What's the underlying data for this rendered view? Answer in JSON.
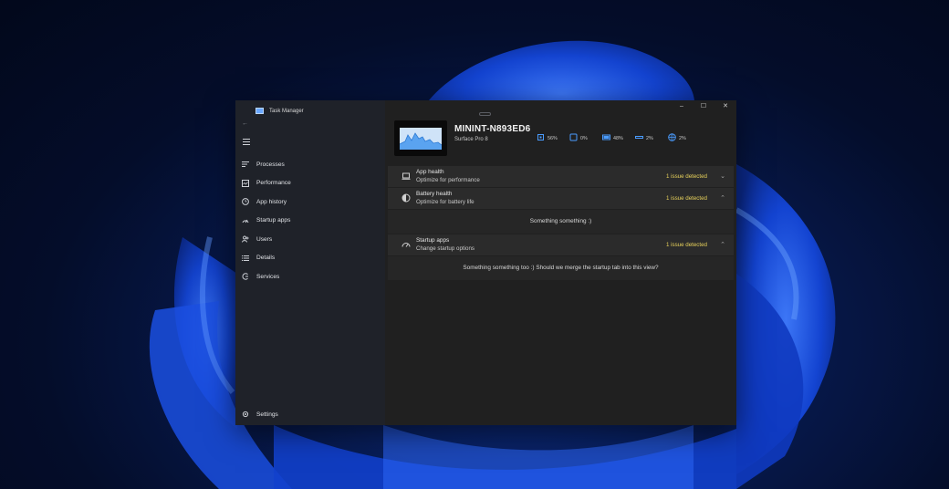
{
  "window": {
    "title": "Task Manager",
    "controls": {
      "minimize": "–",
      "maximize": "☐",
      "close": "✕"
    }
  },
  "sidebar": {
    "back": "←",
    "items": [
      {
        "label": "Processes",
        "icon": "list-icon"
      },
      {
        "label": "Performance",
        "icon": "performance-icon"
      },
      {
        "label": "App history",
        "icon": "history-icon"
      },
      {
        "label": "Startup apps",
        "icon": "startup-icon"
      },
      {
        "label": "Users",
        "icon": "users-icon"
      },
      {
        "label": "Details",
        "icon": "details-icon"
      },
      {
        "label": "Services",
        "icon": "services-icon"
      }
    ],
    "settings_label": "Settings"
  },
  "header": {
    "machine_name": "MININT-N893ED6",
    "model": "Surface Pro 8",
    "metrics": [
      {
        "name": "cpu",
        "value": "56%"
      },
      {
        "name": "memory",
        "value": "0%"
      },
      {
        "name": "disk",
        "value": "48%"
      },
      {
        "name": "network",
        "value": "2%"
      },
      {
        "name": "gpu",
        "value": "2%"
      }
    ]
  },
  "cards": [
    {
      "title": "App health",
      "subtitle": "Optimize for performance",
      "status": "1 issue detected",
      "expanded_text": ""
    },
    {
      "title": "Battery health",
      "subtitle": "Optimize for battery life",
      "status": "1 issue detected",
      "expanded_text": "Something something :)"
    },
    {
      "title": "Startup apps",
      "subtitle": "Change startup options",
      "status": "1 issue detected",
      "expanded_text": "Something something too :) Should we merge the startup tab into this view?"
    }
  ],
  "colors": {
    "accent": "#4a9cff",
    "warning": "#e8d25b",
    "window_bg": "#202020",
    "sidebar_bg": "#1f2229"
  }
}
